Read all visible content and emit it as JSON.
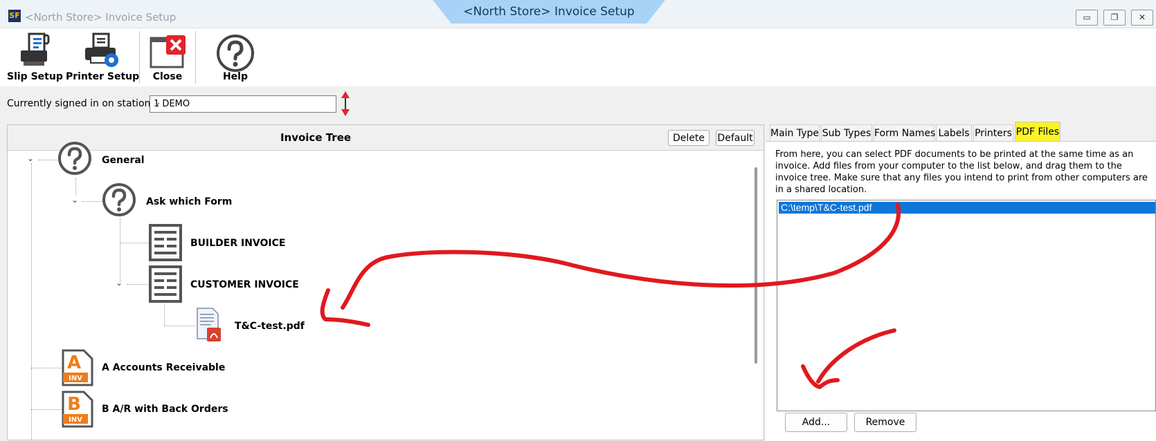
{
  "window": {
    "title": "<North Store> Invoice Setup",
    "tab_title": "<North Store> Invoice Setup",
    "controls": {
      "minimize": "▭",
      "restore": "❐",
      "close": "✕"
    },
    "app_icon": "SF"
  },
  "toolbar": {
    "slip_setup": "Slip Setup",
    "printer_setup": "Printer Setup",
    "close": "Close",
    "help": "Help"
  },
  "station": {
    "label": "Currently signed in on station (1)",
    "value": "1  DEMO"
  },
  "tree": {
    "title": "Invoice Tree",
    "delete_label": "Delete",
    "default_label": "Default",
    "nodes": {
      "general": "General",
      "ask_which_form": "Ask which Form",
      "builder_invoice": "BUILDER INVOICE",
      "customer_invoice": "CUSTOMER INVOICE",
      "tc_pdf": "T&C-test.pdf",
      "accounts_receivable": "A Accounts Receivable",
      "ar_back_orders": "B A/R with Back Orders"
    },
    "badges": {
      "a_letter": "A",
      "b_letter": "B",
      "inv": "INV"
    }
  },
  "tabs": [
    "Main Type",
    "Sub Types",
    "Form Names",
    "Labels",
    "Printers",
    "PDF Files"
  ],
  "active_tab": "PDF Files",
  "pdf_files": {
    "description": "From here, you can select PDF documents to be printed at the same time as an invoice. Add files from your computer to the list below, and drag them to the invoice tree.  Make sure that any files you intend to print from other computers are in a shared location.",
    "items": [
      "C:\\temp\\T&C-test.pdf"
    ],
    "add_label": "Add...",
    "remove_label": "Remove"
  },
  "colors": {
    "active_tab_highlight": "#fbf22a",
    "selection": "#0e76d8",
    "annotation": "#e0191e",
    "invoice_badge": "#ef7d1a"
  }
}
